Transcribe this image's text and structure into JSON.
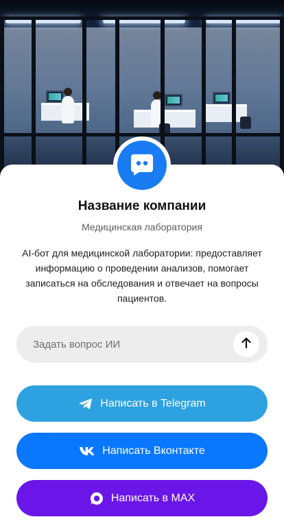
{
  "hero": {
    "image": "night-laboratory-photo"
  },
  "profile": {
    "avatar_icon": "chat-bot-icon",
    "avatar_color": "#1a7cf2",
    "company_name": "Название компании",
    "company_type": "Медицинская лаборатория",
    "description": "AI-бот для медицинской лаборатории: предоставляет информацию о проведении анализов, помогает записаться на обследования и отвечает на вопросы пациентов."
  },
  "ask": {
    "placeholder": "Задать вопрос ИИ",
    "value": "",
    "send_icon": "arrow-up-icon"
  },
  "buttons": {
    "telegram": {
      "label": "Написать в Telegram",
      "icon": "telegram-icon",
      "color": "#2ea2e0"
    },
    "vk": {
      "label": "Написать Вконтакте",
      "icon": "vk-icon",
      "color": "#0a77ff"
    },
    "max": {
      "label": "Написать в MAX",
      "icon": "max-icon",
      "color": "#6b16e8"
    }
  }
}
